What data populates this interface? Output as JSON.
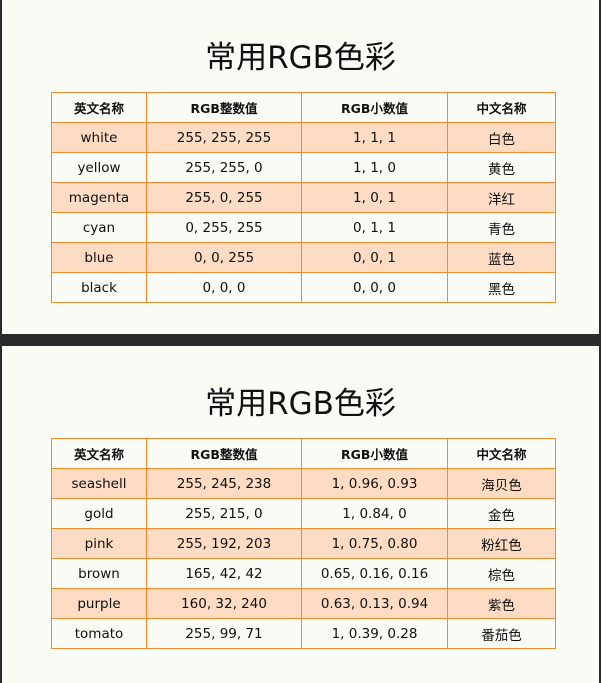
{
  "header": {
    "col_en": "英文名称",
    "col_int": "RGB整数值",
    "col_float": "RGB小数值",
    "col_zh": "中文名称"
  },
  "panels": [
    {
      "title": "常用RGB色彩",
      "rows": [
        {
          "en": "white",
          "int": "255, 255, 255",
          "float": "1, 1, 1",
          "zh": "白色"
        },
        {
          "en": "yellow",
          "int": "255, 255, 0",
          "float": "1, 1, 0",
          "zh": "黄色"
        },
        {
          "en": "magenta",
          "int": "255, 0, 255",
          "float": "1, 0, 1",
          "zh": "洋红"
        },
        {
          "en": "cyan",
          "int": "0, 255, 255",
          "float": "0, 1, 1",
          "zh": "青色"
        },
        {
          "en": "blue",
          "int": "0, 0, 255",
          "float": "0, 0, 1",
          "zh": "蓝色"
        },
        {
          "en": "black",
          "int": "0, 0, 0",
          "float": "0, 0, 0",
          "zh": "黑色"
        }
      ]
    },
    {
      "title": "常用RGB色彩",
      "rows": [
        {
          "en": "seashell",
          "int": "255, 245, 238",
          "float": "1, 0.96, 0.93",
          "zh": "海贝色"
        },
        {
          "en": "gold",
          "int": "255, 215, 0",
          "float": "1, 0.84, 0",
          "zh": "金色"
        },
        {
          "en": "pink",
          "int": "255, 192, 203",
          "float": "1, 0.75, 0.80",
          "zh": "粉红色"
        },
        {
          "en": "brown",
          "int": "165, 42, 42",
          "float": "0.65, 0.16, 0.16",
          "zh": "棕色"
        },
        {
          "en": "purple",
          "int": "160, 32, 240",
          "float": "0.63, 0.13, 0.94",
          "zh": "紫色"
        },
        {
          "en": "tomato",
          "int": "255, 99, 71",
          "float": "1, 0.39, 0.28",
          "zh": "番茄色"
        }
      ]
    }
  ],
  "colors": {
    "border": "#f28a30",
    "row_shaded": "#fddcc3",
    "paper": "#fbfbf6",
    "separator": "#2b2b2b"
  }
}
